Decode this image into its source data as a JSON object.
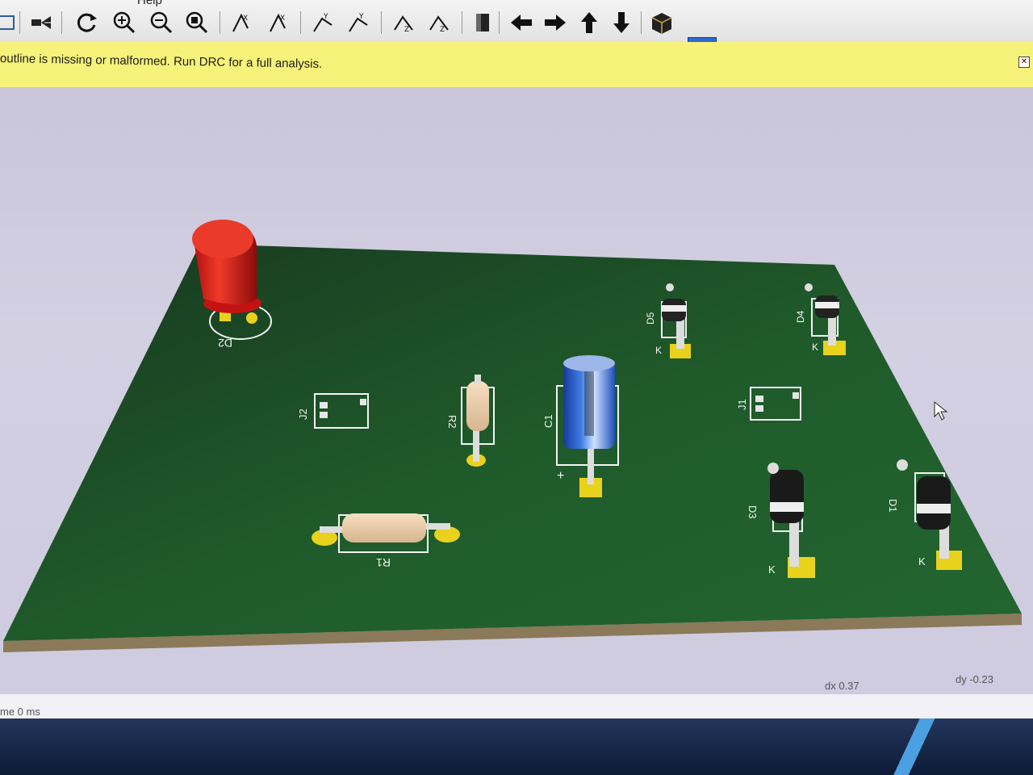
{
  "menu": {
    "partial_label": "Help"
  },
  "toolbar": {
    "buttons": [
      {
        "icon": "frame-icon"
      },
      {
        "icon": "camera-icon"
      },
      {
        "icon": "reload-icon"
      },
      {
        "icon": "zoom-in-icon"
      },
      {
        "icon": "zoom-out-icon"
      },
      {
        "icon": "zoom-fit-icon"
      },
      {
        "icon": "rotate-x-cw-icon"
      },
      {
        "icon": "rotate-x-ccw-icon"
      },
      {
        "icon": "rotate-y-cw-icon"
      },
      {
        "icon": "rotate-y-ccw-icon"
      },
      {
        "icon": "rotate-z-cw-icon"
      },
      {
        "icon": "rotate-z-ccw-icon"
      },
      {
        "icon": "flip-board-icon"
      },
      {
        "icon": "pan-left-icon"
      },
      {
        "icon": "pan-right-icon"
      },
      {
        "icon": "pan-up-icon"
      },
      {
        "icon": "pan-down-icon"
      },
      {
        "icon": "orthographic-icon"
      },
      {
        "icon": "render-mode-icon"
      }
    ]
  },
  "warning": {
    "text": "outline is missing or malformed. Run DRC for a full analysis.",
    "close_icon": "close-icon"
  },
  "board": {
    "colors": {
      "pcb": "#1f5a2a",
      "edge": "#8a7a5a",
      "pad": "#e8d21c",
      "silk": "#f4f4f4",
      "background": "#cdc9de"
    },
    "labels": {
      "d2": "D2",
      "j2": "J2",
      "r2": "R2",
      "c1": "C1",
      "c1_plus": "+",
      "d5": "D5",
      "d5_k": "K",
      "d4": "D4",
      "d4_k": "K",
      "j1": "J1",
      "r1": "R1",
      "d3": "D3",
      "d3_k": "K",
      "d1": "D1",
      "d1_k": "K"
    }
  },
  "status": {
    "time_fragment": "me 0 ms",
    "dx": "dx 0.37",
    "dy": "dy -0.23"
  }
}
